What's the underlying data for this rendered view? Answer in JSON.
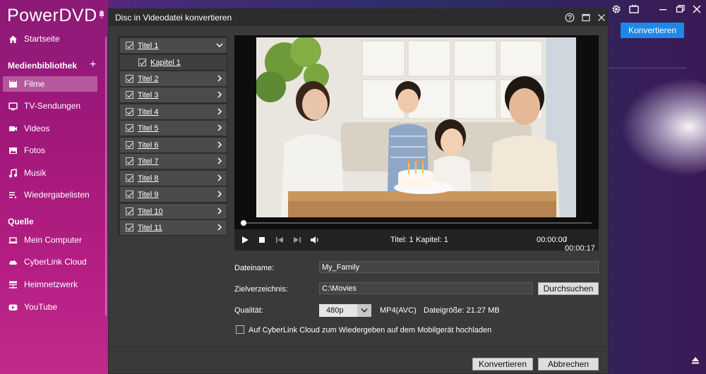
{
  "app": {
    "brand": "PowerDVD",
    "convert_button": "Konvertieren"
  },
  "sidebar": {
    "items_top": [
      {
        "label": "Startseite",
        "icon": "home-icon"
      }
    ],
    "library_header": "Medienbibliothek",
    "library_items": [
      {
        "label": "Filme",
        "icon": "film-icon",
        "active": true
      },
      {
        "label": "TV-Sendungen",
        "icon": "tv-icon"
      },
      {
        "label": "Videos",
        "icon": "video-camera-icon"
      },
      {
        "label": "Fotos",
        "icon": "photo-icon"
      },
      {
        "label": "Musik",
        "icon": "music-note-icon"
      },
      {
        "label": "Wiedergabelisten",
        "icon": "playlist-icon"
      }
    ],
    "source_header": "Quelle",
    "source_items": [
      {
        "label": "Mein Computer",
        "icon": "laptop-icon"
      },
      {
        "label": "CyberLink Cloud",
        "icon": "cloud-icon"
      },
      {
        "label": "Heimnetzwerk",
        "icon": "network-icon"
      },
      {
        "label": "YouTube",
        "icon": "youtube-icon"
      }
    ]
  },
  "dialog": {
    "title": "Disc in Videodatei konvertieren",
    "titles": [
      {
        "label": "Titel 1",
        "checked": true,
        "expanded": true
      },
      {
        "label": "Kapitel 1",
        "checked": true,
        "sub": true
      },
      {
        "label": "Titel 2",
        "checked": true
      },
      {
        "label": "Titel 3",
        "checked": true
      },
      {
        "label": "Titel 4",
        "checked": true
      },
      {
        "label": "Titel 5",
        "checked": true
      },
      {
        "label": "Titel 6",
        "checked": true
      },
      {
        "label": "Titel 7",
        "checked": true
      },
      {
        "label": "Titel 8",
        "checked": true
      },
      {
        "label": "Titel 9",
        "checked": true
      },
      {
        "label": "Titel 10",
        "checked": true
      },
      {
        "label": "Titel 11",
        "checked": true
      }
    ],
    "player": {
      "title_info": "Titel: 1",
      "chapter_info": "Kapitel: 1",
      "time_current": "00:00:00",
      "time_total": "/ 00:00:17",
      "progress": 0
    },
    "form": {
      "filename_label": "Dateiname:",
      "filename_value": "My_Family",
      "target_label": "Zielverzeichnis:",
      "target_value": "C:\\Movies",
      "browse_button": "Durchsuchen",
      "quality_label": "Qualität:",
      "quality_value": "480p",
      "format": "MP4(AVC)",
      "filesize": "Dateigröße: 21.27 MB",
      "upload_label": "Auf CyberLink Cloud zum Wiedergeben auf dem Mobilgerät hochladen",
      "upload_checked": false
    },
    "convert_button": "Konvertieren",
    "cancel_button": "Abbrechen"
  }
}
